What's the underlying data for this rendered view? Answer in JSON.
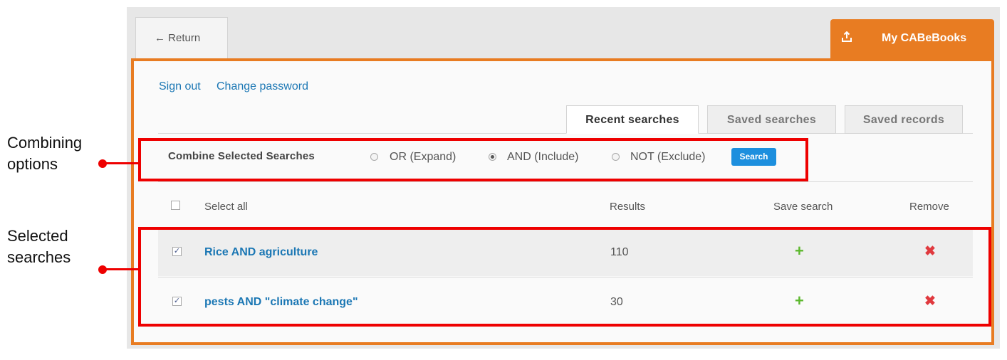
{
  "header": {
    "return_label": "← Return",
    "my_books_label": "My CABeBooks",
    "upload_icon": "upload-icon"
  },
  "account": {
    "sign_out": "Sign out",
    "change_password": "Change password"
  },
  "tabs": [
    {
      "label": "Recent searches",
      "active": true
    },
    {
      "label": "Saved searches",
      "active": false
    },
    {
      "label": "Saved records",
      "active": false
    }
  ],
  "combine": {
    "label": "Combine Selected Searches",
    "options": [
      {
        "label": "OR (Expand)",
        "selected": false
      },
      {
        "label": "AND (Include)",
        "selected": true
      },
      {
        "label": "NOT (Exclude)",
        "selected": false
      }
    ],
    "search_button": "Search"
  },
  "table": {
    "select_all": "Select all",
    "columns": [
      "Results",
      "Save search",
      "Remove"
    ],
    "rows": [
      {
        "query": "Rice AND agriculture",
        "results": "110",
        "checked": true
      },
      {
        "query": "pests AND \"climate change\"",
        "results": "30",
        "checked": true
      }
    ]
  },
  "annotations": {
    "combining": [
      "Combining",
      "options"
    ],
    "selected": [
      "Selected",
      "searches"
    ]
  },
  "colors": {
    "brand_orange": "#e87c22",
    "link_blue": "#1b77b4",
    "search_button_blue": "#1d8fde",
    "add_green": "#5cb82d",
    "remove_red": "#e0393e",
    "annotation_red": "#ee0000"
  }
}
